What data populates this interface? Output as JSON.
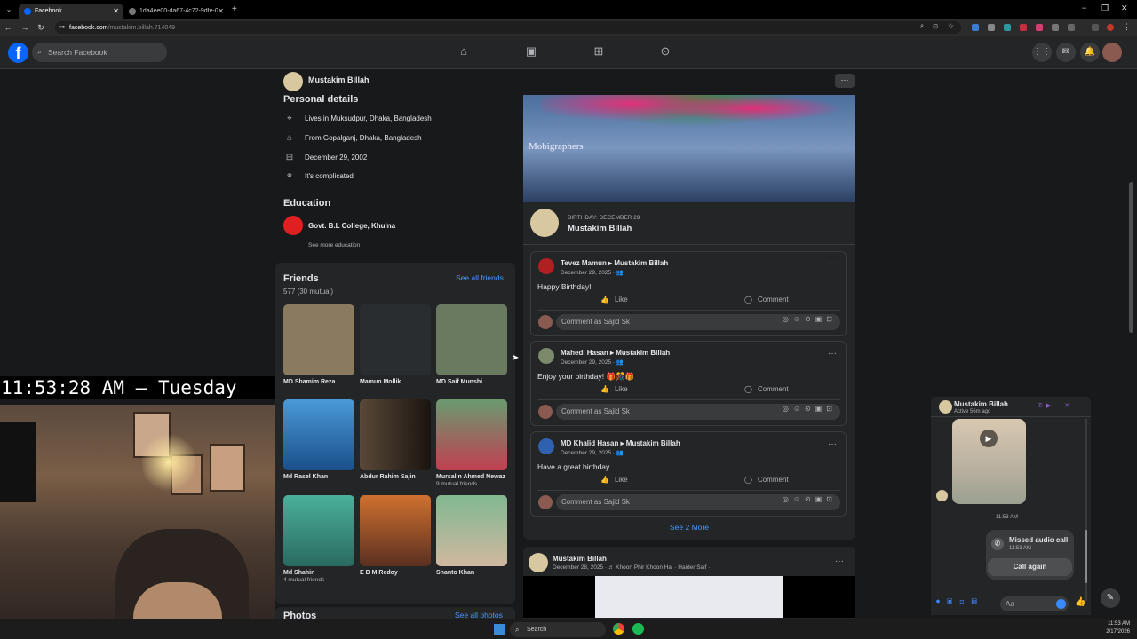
{
  "browser": {
    "tabs": [
      {
        "label": "Facebook",
        "active": true
      },
      {
        "label": "1da4ee00-da67-4c72-9dfe-02!",
        "active": false
      }
    ],
    "url_host": "facebook.com",
    "url_path": "/mustakim.billah.714049",
    "new_tab": "+",
    "win_min": "−",
    "win_max": "❐",
    "win_close": "✕"
  },
  "fb_header": {
    "logo": "f",
    "search_placeholder": "Search Facebook",
    "nav_icons": [
      "home-icon",
      "video-icon",
      "marketplace-icon",
      "gaming-icon"
    ],
    "right_icons": [
      "menu-grid-icon",
      "messenger-icon",
      "notifications-icon",
      "profile-avatar"
    ]
  },
  "profile": {
    "name": "Mustakim Billah",
    "more": "···"
  },
  "personal_details": {
    "heading": "Personal details",
    "rows": [
      {
        "icon": "location-pin-icon",
        "text": "Lives in Muksudpur, Dhaka, Bangladesh"
      },
      {
        "icon": "home-icon",
        "text": "From Gopalganj, Dhaka, Bangladesh"
      },
      {
        "icon": "birthday-cake-icon",
        "text": "December 29, 2002"
      },
      {
        "icon": "relationship-icon",
        "text": "It's complicated"
      }
    ]
  },
  "education": {
    "heading": "Education",
    "school": "Govt. B.L College, Khulna",
    "see_more": "See more education"
  },
  "friends": {
    "heading": "Friends",
    "count": "577 (30 mutual)",
    "see_all": "See all friends",
    "list": [
      {
        "name": "MD Shamim Reza",
        "mutual": "",
        "color": "#8a7a60"
      },
      {
        "name": "Mamun Mollik",
        "mutual": "",
        "color": "#2a2d30"
      },
      {
        "name": "MD Saif Munshi",
        "mutual": "",
        "color": "#6a7a60"
      },
      {
        "name": "Md Rasel Khan",
        "mutual": "",
        "color": "#2a6fb0"
      },
      {
        "name": "Abdur Rahim Sajin",
        "mutual": "",
        "color": "#3a3028"
      },
      {
        "name": "Mursalin Ahmed Newaz",
        "mutual": "9 mutual friends",
        "color": "#a04048"
      },
      {
        "name": "Md Shahin",
        "mutual": "4 mutual friends",
        "color": "#3a8a70"
      },
      {
        "name": "E D M Redoy",
        "mutual": "",
        "color": "#a06030"
      },
      {
        "name": "Shanto Khan",
        "mutual": "",
        "color": "#6aa080"
      }
    ]
  },
  "photos": {
    "heading": "Photos",
    "see_all": "See all photos"
  },
  "overlay": {
    "clock": "11:53:28 AM – Tuesday"
  },
  "birthday_post": {
    "banner_text": "Mobigraphers",
    "label": "BIRTHDAY: DECEMBER 29",
    "name": "Mustakim Billah",
    "comments": [
      {
        "author": "Tevez Mamun ▸ Mustakim Billah",
        "date": "December 29, 2025 · ",
        "message": "Happy Birthday!",
        "avatar_color": "#b02020"
      },
      {
        "author": "Mahedi Hasan ▸ Mustakim Billah",
        "date": "December 29, 2025 · ",
        "message": "Enjoy your birthday! 🎁🎊🎁",
        "avatar_color": "#7a8a6a"
      },
      {
        "author": "MD Khalid Hasan ▸ Mustakim Billah",
        "date": "December 29, 2025 · ",
        "message": "Have a great birthday.",
        "avatar_color": "#3060b0"
      }
    ],
    "like": "Like",
    "comment": "Comment",
    "comment_as": "Comment as Sajid Sk",
    "see_more": "See 2 More"
  },
  "next_post": {
    "author": "Mustakim Billah",
    "meta": "December 28, 2025 · ♬ Khoon Phir Khoon Hai · Haider Saif ·",
    "more": "···"
  },
  "chat": {
    "name": "Mustakim Billah",
    "status": "Active 56m ago",
    "time": "11:53 AM",
    "missed_title": "Missed audio call",
    "missed_time": "11:53 AM",
    "call_again": "Call again",
    "input_placeholder": "Aa"
  },
  "taskbar": {
    "search": "Search",
    "time": "11:53 AM",
    "date": "2/17/2026"
  },
  "colors": {
    "accent": "#0866ff",
    "link": "#4599ff"
  }
}
